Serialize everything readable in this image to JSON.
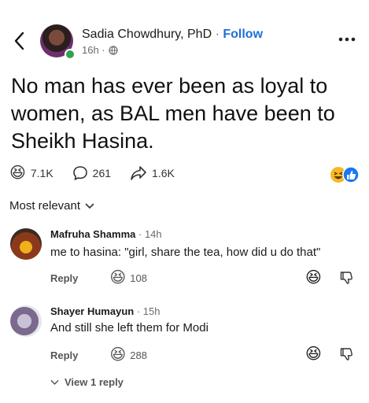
{
  "post": {
    "author_name": "Sadia Chowdhury, PhD",
    "separator": "·",
    "follow_label": "Follow",
    "time": "16h ·",
    "text": "No man has ever been as loyal to women, as BAL men have been to Sheikh Hasina.",
    "reactions_count": "7.1K",
    "comments_count": "261",
    "shares_count": "1.6K"
  },
  "sort": {
    "label": "Most relevant"
  },
  "comments": [
    {
      "name": "Mafruha Shamma",
      "time": "· 14h",
      "text": "me to hasina: \"girl, share the tea, how did u do that\"",
      "reply_label": "Reply",
      "reaction_count": "108"
    },
    {
      "name": "Shayer Humayun",
      "time": "· 15h",
      "text": "And still she left them for Modi",
      "reply_label": "Reply",
      "reaction_count": "288"
    }
  ],
  "view_replies": {
    "label": "View 1 reply"
  },
  "colors": {
    "accent": "#1e6fd6",
    "online": "#2ea44f",
    "haha": "#f7b928",
    "like": "#1877f2"
  },
  "icons": [
    "back-arrow-icon",
    "globe-icon",
    "more-icon",
    "haha-emoji-icon",
    "comment-icon",
    "share-icon",
    "like-icon",
    "dislike-icon",
    "chevron-down-icon"
  ]
}
